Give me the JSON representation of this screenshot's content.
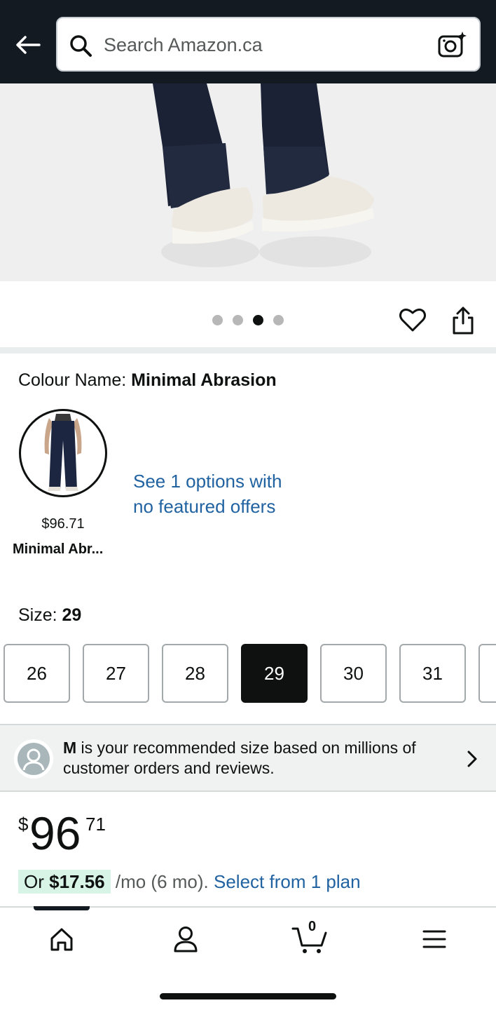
{
  "header": {
    "back_icon": "arrow-left-icon",
    "search_placeholder": "Search Amazon.ca",
    "camera_icon": "camera-sparkle-icon",
    "background": "#131a22"
  },
  "product_image": {
    "carousel_total": 4,
    "carousel_active_index": 2
  },
  "actions": {
    "heart_icon": "heart-icon",
    "share_icon": "share-icon"
  },
  "colour": {
    "label": "Colour Name: ",
    "value": "Minimal Abrasion",
    "swatch_price": "$96.71",
    "swatch_name": "Minimal Abr...",
    "see_options_line1": "See 1 options with",
    "see_options_line2": "no featured offers",
    "link_color": "#2162a1"
  },
  "size": {
    "label": "Size: ",
    "value": "29",
    "options": [
      "26",
      "27",
      "28",
      "29",
      "30",
      "31"
    ],
    "selected": "29"
  },
  "recommendation": {
    "size_letter": "M",
    "text": " is your recommended size based on millions of customer orders and reviews."
  },
  "price": {
    "symbol": "$",
    "whole": "96",
    "fraction": "71",
    "monthly_prefix": "Or ",
    "monthly_amount": "$17.56",
    "monthly_suffix": " /mo (6 mo). ",
    "monthly_link": "Select from 1 plan"
  },
  "bottom_nav": {
    "items": [
      "home-icon",
      "account-icon",
      "cart-icon",
      "menu-icon"
    ],
    "cart_count": "0"
  }
}
